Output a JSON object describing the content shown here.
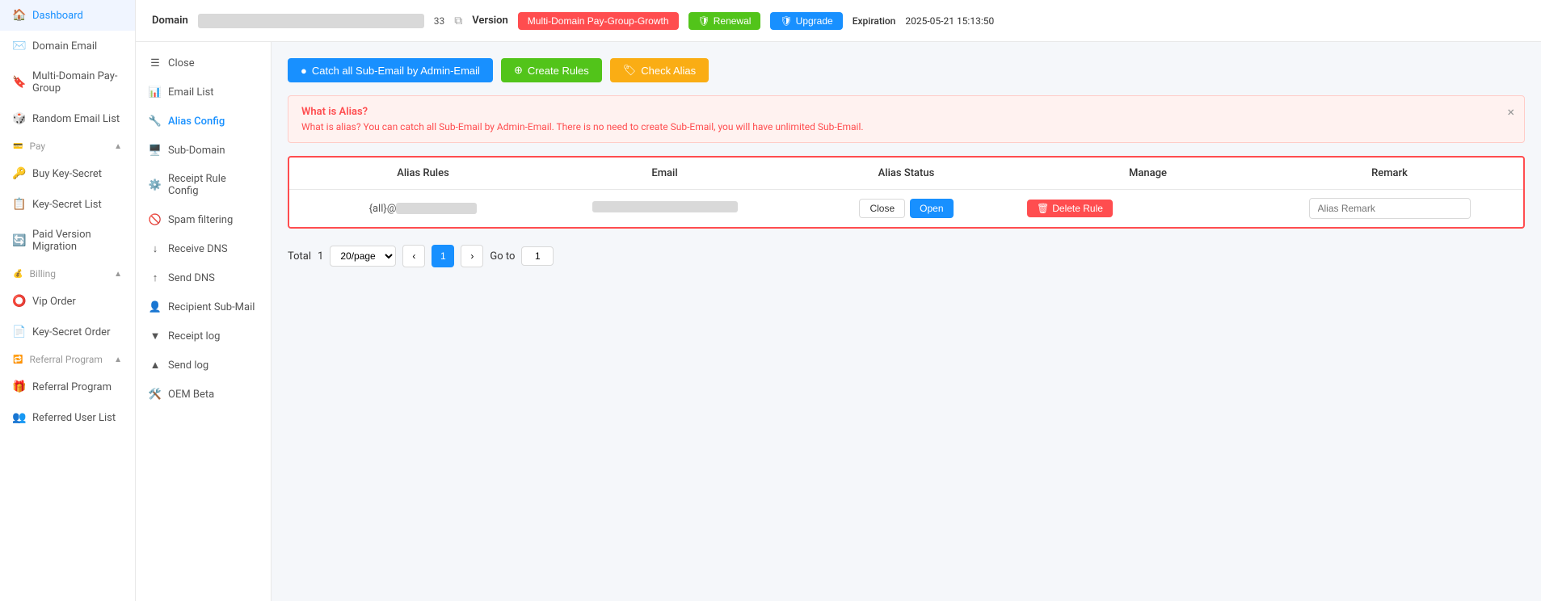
{
  "sidebar": {
    "items": [
      {
        "id": "dashboard",
        "label": "Dashboard",
        "icon": "🏠"
      },
      {
        "id": "domain-email",
        "label": "Domain Email",
        "icon": "✉️"
      },
      {
        "id": "multi-domain",
        "label": "Multi-Domain Pay-Group",
        "icon": "🔖"
      },
      {
        "id": "random-email",
        "label": "Random Email List",
        "icon": "🎲"
      },
      {
        "id": "pay",
        "label": "Pay",
        "icon": "💳",
        "expandable": true
      },
      {
        "id": "buy-key-secret",
        "label": "Buy Key-Secret",
        "icon": "🔑"
      },
      {
        "id": "key-secret-list",
        "label": "Key-Secret List",
        "icon": "📋"
      },
      {
        "id": "paid-version-migration",
        "label": "Paid Version Migration",
        "icon": "🔄"
      },
      {
        "id": "billing",
        "label": "Billing",
        "icon": "💰",
        "expandable": true
      },
      {
        "id": "vip-order",
        "label": "Vip Order",
        "icon": "⭕"
      },
      {
        "id": "key-secret-order",
        "label": "Key-Secret Order",
        "icon": "📄"
      },
      {
        "id": "referral-program",
        "label": "Referral Program",
        "icon": "🔁",
        "expandable": true
      },
      {
        "id": "referral-program-2",
        "label": "Referral Program",
        "icon": "🎁"
      },
      {
        "id": "referred-user-list",
        "label": "Referred User List",
        "icon": "👥"
      }
    ]
  },
  "top_bar": {
    "domain_label": "Domain",
    "domain_value": "██████████████████ 33",
    "version_label": "Version",
    "version_badge": "Multi-Domain Pay-Group-Growth",
    "renewal_label": "Renewal",
    "upgrade_label": "Upgrade",
    "expiration_label": "Expiration",
    "expiration_value": "2025-05-21 15:13:50"
  },
  "sub_nav": {
    "items": [
      {
        "id": "close",
        "label": "Close",
        "icon": "☰"
      },
      {
        "id": "email-list",
        "label": "Email List",
        "icon": "📊"
      },
      {
        "id": "alias-config",
        "label": "Alias Config",
        "icon": "🔧",
        "active": true
      },
      {
        "id": "sub-domain",
        "label": "Sub-Domain",
        "icon": "🖥️"
      },
      {
        "id": "receipt-rule-config",
        "label": "Receipt Rule Config",
        "icon": "⚙️"
      },
      {
        "id": "spam-filtering",
        "label": "Spam filtering",
        "icon": "🚫"
      },
      {
        "id": "receive-dns",
        "label": "Receive DNS",
        "icon": "↓"
      },
      {
        "id": "send-dns",
        "label": "Send DNS",
        "icon": "↑"
      },
      {
        "id": "recipient-sub-mail",
        "label": "Recipient Sub-Mail",
        "icon": "👤"
      },
      {
        "id": "receipt-log",
        "label": "Receipt log",
        "icon": "▼"
      },
      {
        "id": "send-log",
        "label": "Send log",
        "icon": "▲"
      },
      {
        "id": "oem",
        "label": "OEM Beta",
        "icon": "🛠️"
      }
    ]
  },
  "action_buttons": {
    "catch_all": "Catch all Sub-Email by Admin-Email",
    "create_rules": "Create Rules",
    "check_alias": "Check Alias"
  },
  "info_box": {
    "title": "What is Alias?",
    "text": "What is alias? You can catch all Sub-Email by Admin-Email. There is no need to create Sub-Email, you will have unlimited Sub-Email."
  },
  "table": {
    "headers": [
      "Alias Rules",
      "Email",
      "Alias Status",
      "Manage",
      "Remark"
    ],
    "rows": [
      {
        "alias_rules": "{all}@██████████████",
        "email": "████████████████████",
        "close_btn": "Close",
        "open_btn": "Open",
        "delete_btn": "Delete Rule",
        "remark_placeholder": "Alias Remark"
      }
    ]
  },
  "pagination": {
    "total_label": "Total",
    "total_count": "1",
    "per_page": "20/page",
    "current_page": "1",
    "goto_label": "Go to",
    "goto_value": "1"
  }
}
